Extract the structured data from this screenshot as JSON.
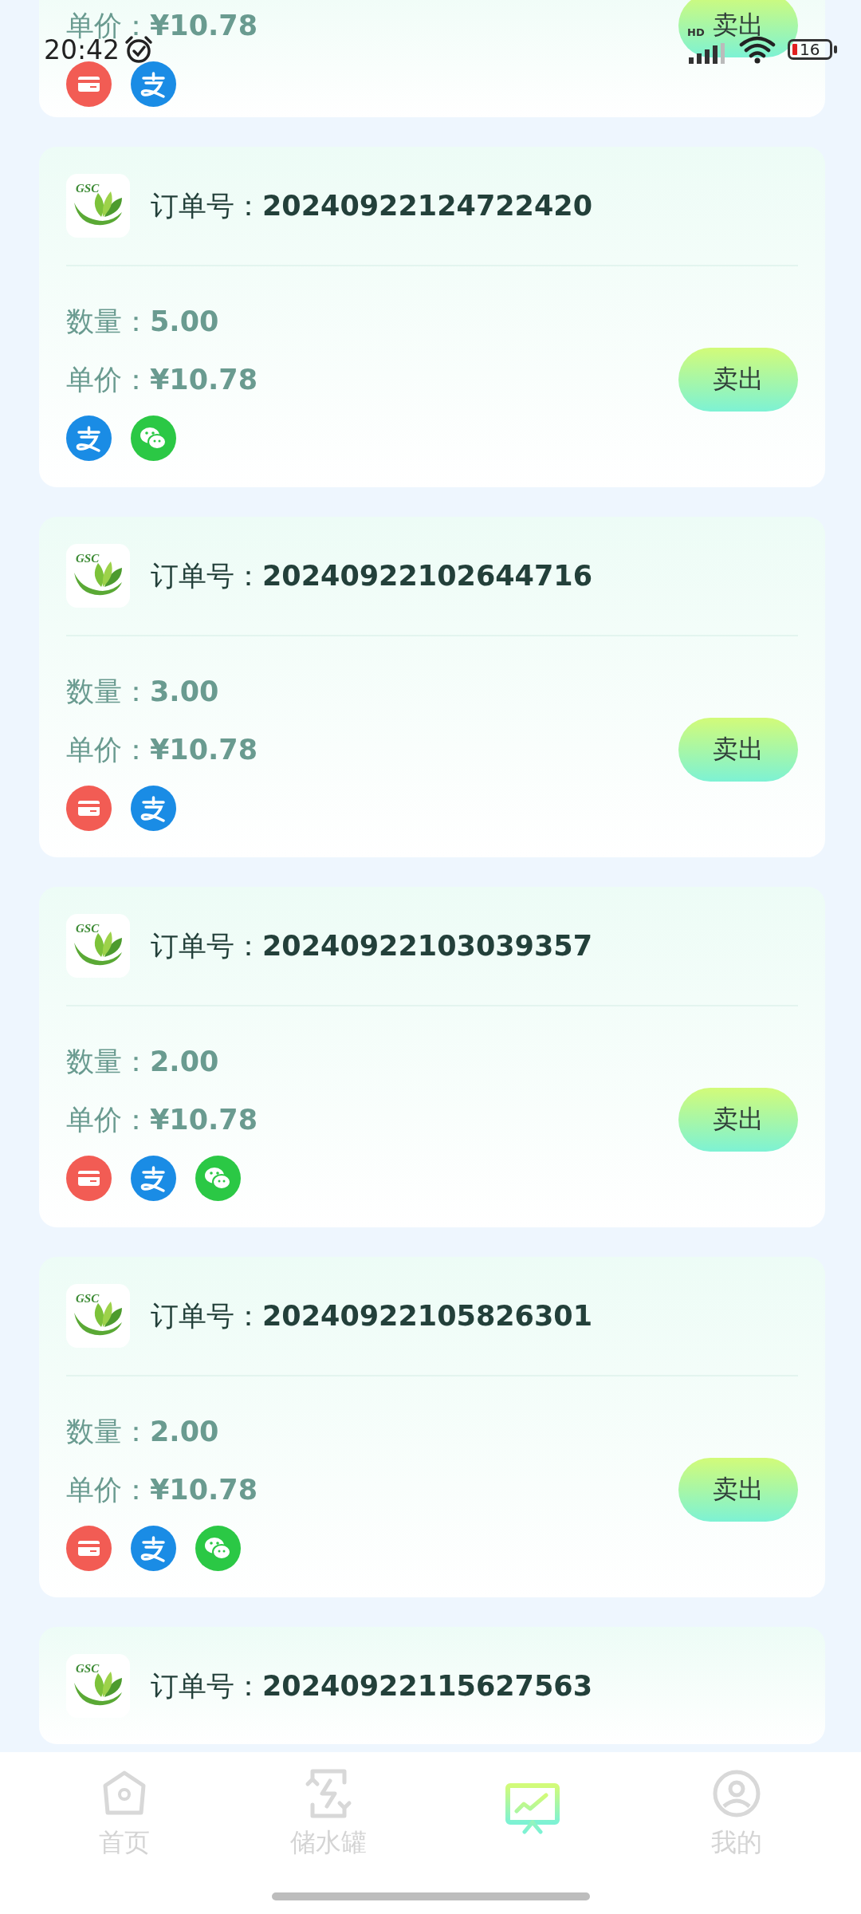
{
  "status_bar": {
    "time": "20:42",
    "network": "HD",
    "battery": "16"
  },
  "orders": [
    {
      "price_label": "单价：",
      "price": "¥10.78",
      "sell": "卖出",
      "payments": [
        {
          "kind": "card"
        },
        {
          "kind": "alipay"
        }
      ]
    },
    {
      "logo": "GSC",
      "order_label": "订单号：",
      "order_no": "20240922124722420",
      "qty_label": "数量：",
      "qty": "5.00",
      "price_label": "单价：",
      "price": "¥10.78",
      "sell": "卖出",
      "payments": [
        {
          "kind": "alipay"
        },
        {
          "kind": "wechat"
        }
      ]
    },
    {
      "logo": "GSC",
      "order_label": "订单号：",
      "order_no": "20240922102644716",
      "qty_label": "数量：",
      "qty": "3.00",
      "price_label": "单价：",
      "price": "¥10.78",
      "sell": "卖出",
      "payments": [
        {
          "kind": "card"
        },
        {
          "kind": "alipay"
        }
      ]
    },
    {
      "logo": "GSC",
      "order_label": "订单号：",
      "order_no": "20240922103039357",
      "qty_label": "数量：",
      "qty": "2.00",
      "price_label": "单价：",
      "price": "¥10.78",
      "sell": "卖出",
      "payments": [
        {
          "kind": "card"
        },
        {
          "kind": "alipay"
        },
        {
          "kind": "wechat"
        }
      ]
    },
    {
      "logo": "GSC",
      "order_label": "订单号：",
      "order_no": "20240922105826301",
      "qty_label": "数量：",
      "qty": "2.00",
      "price_label": "单价：",
      "price": "¥10.78",
      "sell": "卖出",
      "payments": [
        {
          "kind": "card"
        },
        {
          "kind": "alipay"
        },
        {
          "kind": "wechat"
        }
      ]
    },
    {
      "logo": "GSC",
      "order_label": "订单号：",
      "order_no": "20240922115627563"
    }
  ],
  "nav": [
    {
      "label": "首页",
      "selected": false
    },
    {
      "label": "储水罐",
      "selected": false
    },
    {
      "selected": true
    },
    {
      "label": "我的",
      "selected": false
    }
  ]
}
